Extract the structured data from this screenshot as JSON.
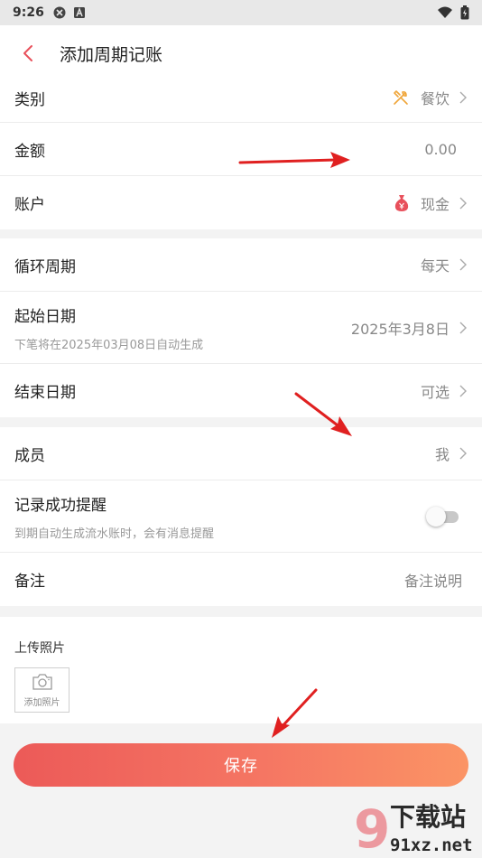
{
  "status_bar": {
    "time": "9:26"
  },
  "header": {
    "title": "添加周期记账"
  },
  "basic": {
    "category": {
      "label": "类别",
      "value": "餐饮"
    },
    "amount": {
      "label": "金额",
      "value": "0.00"
    },
    "account": {
      "label": "账户",
      "value": "现金"
    }
  },
  "schedule": {
    "cycle": {
      "label": "循环周期",
      "value": "每天"
    },
    "start": {
      "label": "起始日期",
      "sub": "下笔将在2025年03月08日自动生成",
      "value": "2025年3月8日"
    },
    "end": {
      "label": "结束日期",
      "value": "可选"
    }
  },
  "extra": {
    "member": {
      "label": "成员",
      "value": "我"
    },
    "reminder": {
      "label": "记录成功提醒",
      "sub": "到期自动生成流水账时，会有消息提醒",
      "enabled": false
    },
    "note": {
      "label": "备注",
      "placeholder": "备注说明"
    }
  },
  "upload": {
    "title": "上传照片",
    "button_label": "添加照片"
  },
  "save_label": "保存",
  "watermark": {
    "line1": "下载站",
    "line2": "91xz.net"
  },
  "colors": {
    "accent": "#e8505b",
    "button_start": "#ec5a58",
    "button_end": "#fb9465",
    "annotation": "#e02020"
  }
}
